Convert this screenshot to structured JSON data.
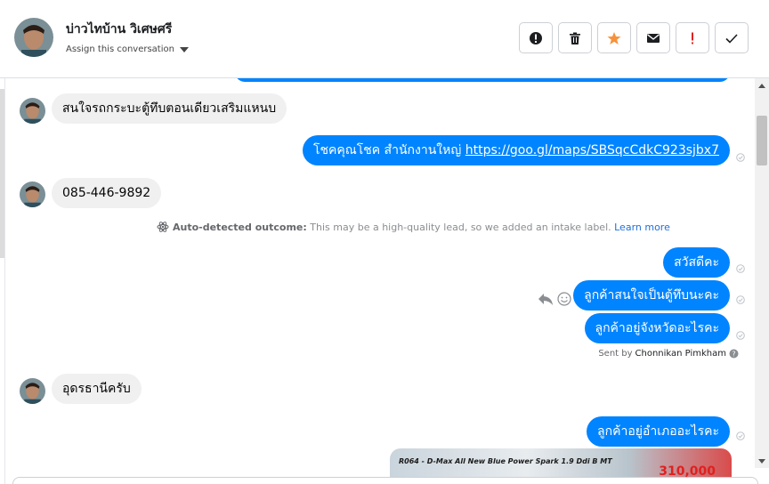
{
  "header": {
    "contact_name": "บ่าวไทบ้าน วิเศษศรี",
    "assign_label": "Assign this conversation"
  },
  "toolbar": [
    {
      "name": "mark-spam-button",
      "icon": "exclamation-circle-icon"
    },
    {
      "name": "delete-button",
      "icon": "trash-icon"
    },
    {
      "name": "star-button",
      "icon": "star-icon",
      "color": "#f7923a"
    },
    {
      "name": "mark-unread-button",
      "icon": "envelope-icon"
    },
    {
      "name": "follow-up-button",
      "icon": "exclamation-icon",
      "color": "#e02020"
    },
    {
      "name": "mark-done-button",
      "icon": "check-icon"
    }
  ],
  "thread": {
    "msg1": "สนใจรถกระบะตู้ทึบตอนเดียวเสริมแหนบ",
    "msg2_prefix": "โชคคุณโชค สำนักงานใหญ่ ",
    "msg2_link": "https://goo.gl/maps/SBSqcCdkC923sjbx7",
    "msg3": "085-446-9892",
    "auto_outcome_label": "Auto-detected outcome:",
    "auto_outcome_text": " This may be a high-quality lead, so we added an intake label.",
    "learn_more": "Learn more",
    "msg4": "สวัสดีคะ",
    "msg5": "ลูกค้าสนใจเป็นตู้ทึบนะคะ",
    "msg6": "ลูกค้าอยู่จังหวัดอะไรคะ",
    "sent_by_prefix": "Sent by",
    "sent_by_name": "Chonnikan Pimkham",
    "msg7": "อุดรธานีครับ",
    "msg8": "ลูกค้าอยู่อำเภออะไรคะ",
    "ad_text": "R064 - D-Max All New Blue Power Spark 1.9 Ddi B MT",
    "ad_price": "310,000"
  },
  "colors": {
    "outgoing_bubble": "#0084ff",
    "incoming_bubble": "#f0f0f0",
    "link": "#216fdb"
  }
}
